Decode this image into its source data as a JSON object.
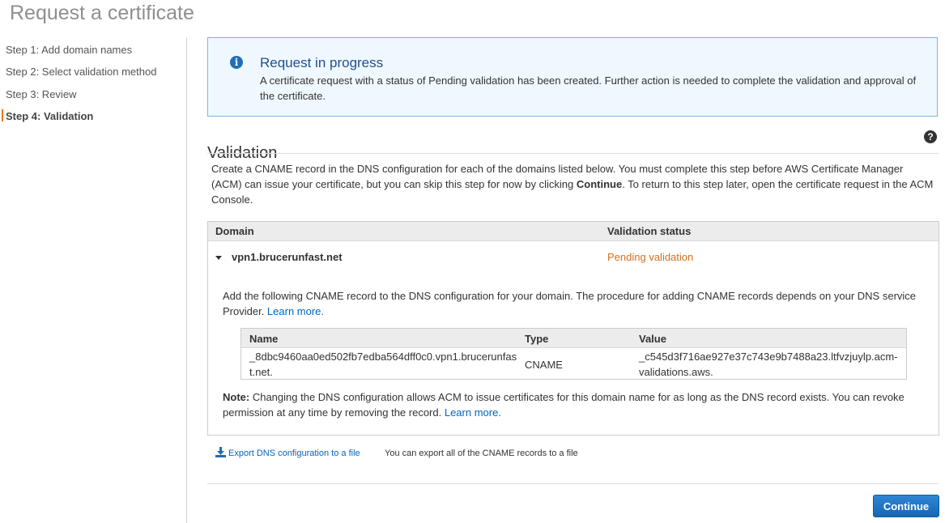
{
  "page": {
    "title": "Request a certificate"
  },
  "sidebar": {
    "steps": [
      {
        "label": "Step 1: Add domain names"
      },
      {
        "label": "Step 2: Select validation method"
      },
      {
        "label": "Step 3: Review"
      },
      {
        "label": "Step 4: Validation"
      }
    ],
    "active_step": 4
  },
  "info": {
    "icon": "info-icon",
    "title": "Request in progress",
    "text": "A certificate request with a status of Pending validation has been created. Further action is needed to complete the validation and approval of the certificate."
  },
  "validation": {
    "title": "Validation",
    "help_icon": "?",
    "desc_part1": "Create a CNAME record in the DNS configuration for each of the domains listed below. You must complete this step before AWS Certificate Manager (ACM) can issue your certificate, but you can skip this step for now by clicking ",
    "desc_bold": "Continue",
    "desc_part2": ". To return to this step later, open the certificate request in the ACM Console."
  },
  "domain_table": {
    "headers": {
      "domain": "Domain",
      "status": "Validation status"
    },
    "row": {
      "domain": "vpn1.brucerunfast.net",
      "status": "Pending validation",
      "status_color": "#d4711d",
      "cname_desc": "Add the following CNAME record to the DNS configuration for your domain. The procedure for adding CNAME records depends on your DNS service Provider. ",
      "cname_learn_more": "Learn more.",
      "cname_table": {
        "headers": {
          "name": "Name",
          "type": "Type",
          "value": "Value"
        },
        "name": "_8dbc9460aa0ed502fb7edba564dff0c0.vpn1.brucerunfast.net.",
        "type": "CNAME",
        "value": "_c545d3f716ae927e37c743e9b7488a23.ltfvzjuylp.acm-validations.aws."
      },
      "note_label": "Note:",
      "note_text": " Changing the DNS configuration allows ACM to issue certificates for this domain name for as long as the DNS record exists. You can revoke permission at any time by removing the record. ",
      "note_learn_more": "Learn more."
    }
  },
  "export": {
    "link_label": "Export DNS configuration to a file",
    "hint": "You can export all of the CNAME records to a file",
    "icon": "download-icon"
  },
  "actions": {
    "continue_label": "Continue"
  },
  "colors": {
    "accent": "#ec7211",
    "link": "#0066c0",
    "button": "#1f78c8",
    "info_border": "#79b8dd",
    "info_bg": "#f0f8ff"
  }
}
